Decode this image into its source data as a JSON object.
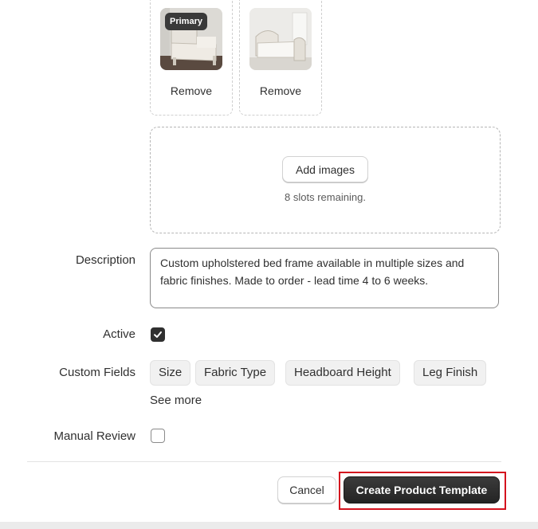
{
  "images": [
    {
      "badge": "Primary",
      "remove_label": "Remove"
    },
    {
      "badge": "",
      "remove_label": "Remove"
    }
  ],
  "dropzone": {
    "button_label": "Add images",
    "slots_text": "8 slots remaining."
  },
  "description": {
    "label": "Description",
    "value": "Custom upholstered bed frame available in multiple sizes and fabric finishes. Made to order - lead time 4 to 6 weeks."
  },
  "active": {
    "label": "Active",
    "checked": true
  },
  "custom_fields": {
    "label": "Custom Fields",
    "chips": [
      "Size",
      "Fabric Type",
      "Headboard Height",
      "Leg Finish"
    ],
    "see_more": "See more"
  },
  "manual_review": {
    "label": "Manual Review",
    "checked": false
  },
  "footer": {
    "cancel_label": "Cancel",
    "submit_label": "Create Product Template"
  }
}
